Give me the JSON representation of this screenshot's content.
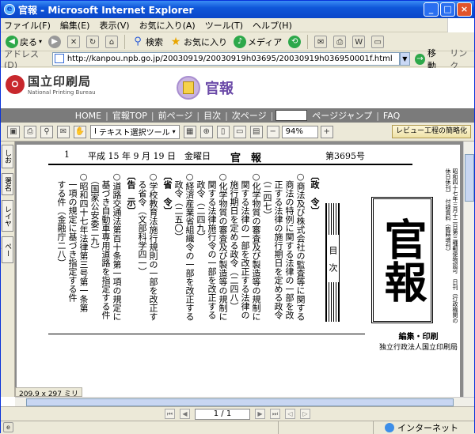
{
  "window": {
    "title": "官報 - Microsoft Internet Explorer",
    "min": "_",
    "max": "□",
    "close": "×"
  },
  "menu": [
    "ファイル(F)",
    "編集(E)",
    "表示(V)",
    "お気に入り(A)",
    "ツール(T)",
    "ヘルプ(H)"
  ],
  "toolbar": {
    "back": "戻る",
    "search": "検索",
    "favorites": "お気に入り",
    "media": "メディア"
  },
  "address": {
    "label": "アドレス(D)",
    "url": "http://kanpou.npb.go.jp/20030919/20030919h03695/20030919h036950001f.html",
    "go": "移動",
    "links": "リンク"
  },
  "site": {
    "logo_jp": "国立印刷局",
    "logo_en": "National Printing Bureau",
    "title": "官報"
  },
  "nav": {
    "home": "HOME",
    "kanpo_top": "官報TOP",
    "prev_page": "前ページ",
    "toc": "目次",
    "next_page": "次ページ",
    "page_jump": "ページジャンプ",
    "faq": "FAQ"
  },
  "acrobat": {
    "text_select": "テキスト選択ツール",
    "zoom": "94%",
    "review": "レビュー工程の簡略化",
    "page_size": "209.9 x 297 ミリ",
    "page_indicator": "1 / 1",
    "side_tabs": [
      "しおり",
      "署名",
      "レイヤー",
      "ページ"
    ]
  },
  "status": {
    "zone": "インターネット"
  },
  "gazette": {
    "page_no": "1",
    "date": "平成 15 年 9 月 19 日　金曜日",
    "name": "官　報",
    "issue": "第3695号",
    "masthead": "官報",
    "contents": "目　次",
    "editor_line1": "編集・印刷",
    "editor_line2": "独立行政法人国立印刷局",
    "columns": [
      {
        "text": "〔政　令〕",
        "bold": true
      },
      {
        "text": "○商法及び株式会社の監査等に関する",
        "bold": false
      },
      {
        "text": "　商法の特例に関する法律の一部を改",
        "bold": false
      },
      {
        "text": "　正する法律の施行期日を定める政令",
        "bold": false
      },
      {
        "text": "　（二四七）",
        "bold": false
      },
      {
        "text": "○化学物質の審査及び製造等の規制に",
        "bold": false
      },
      {
        "text": "　関する法律の一部を改正する法律の",
        "bold": false
      },
      {
        "text": "　施行期日を定める政令（二四八）",
        "bold": false
      },
      {
        "text": "○化学物質の審査及び製造等の規制に",
        "bold": false
      },
      {
        "text": "　関する法律施行令の一部を改正する",
        "bold": false
      },
      {
        "text": "　政令（二四九）",
        "bold": false
      },
      {
        "text": "○経済産業省組織令の一部を改正する",
        "bold": false
      },
      {
        "text": "　政令（二五〇）",
        "bold": false
      },
      {
        "text": "〔省　令〕",
        "bold": true
      },
      {
        "text": "○学校教育法施行規則の一部を改正す",
        "bold": false
      },
      {
        "text": "　る省令（文部科学四一）",
        "bold": false
      },
      {
        "text": "〔告　示〕",
        "bold": true
      },
      {
        "text": "○道路交通法第百十条第一項の規定に",
        "bold": false
      },
      {
        "text": "　基づき自動車専用道路を指定する件",
        "bold": false
      },
      {
        "text": "　（国家公安委二九）",
        "bold": false
      },
      {
        "text": "○昭和四十七年法律第三号第一条第",
        "bold": false
      },
      {
        "text": "　一項の規定に基づき指定する件",
        "bold": false
      },
      {
        "text": "　する件（金融庁二八）",
        "bold": false
      }
    ],
    "right_col": "昭和四十七年三月十二日第三種郵便物認可　日刊（行政機関の休日休刊）　付録資料（臨時増刊）"
  }
}
